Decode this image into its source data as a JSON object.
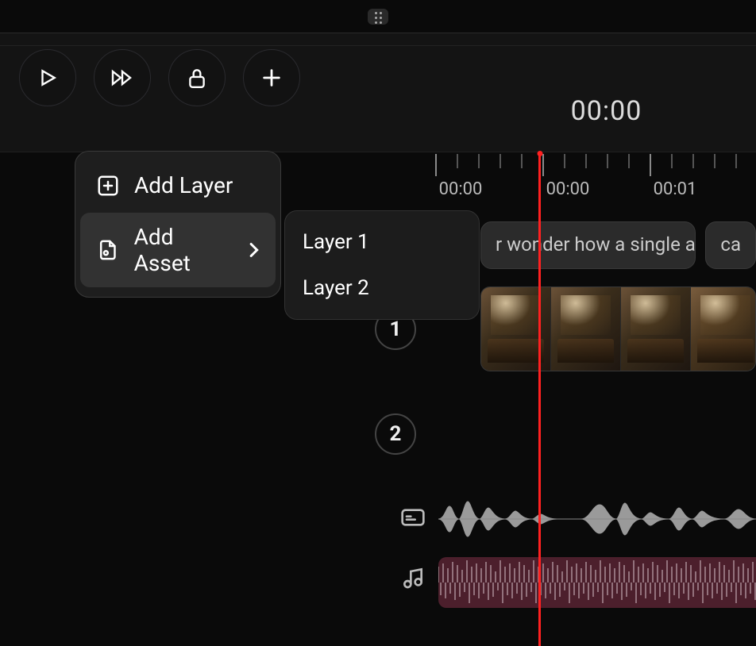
{
  "header": {},
  "toolbar": {
    "play": "play",
    "forward": "forward",
    "lock": "lock",
    "add": "add"
  },
  "timecode": "00:00",
  "menu": {
    "add_layer": "Add Layer",
    "add_asset": "Add Asset",
    "submenu": [
      "Layer 1",
      "Layer 2"
    ]
  },
  "ruler": {
    "labels": [
      "00:00",
      "00:00",
      "00:01"
    ]
  },
  "tracks": {
    "textA": "r wonder how a single a...",
    "textB": "ca",
    "layer1_badge": "1",
    "layer2_badge": "2"
  }
}
